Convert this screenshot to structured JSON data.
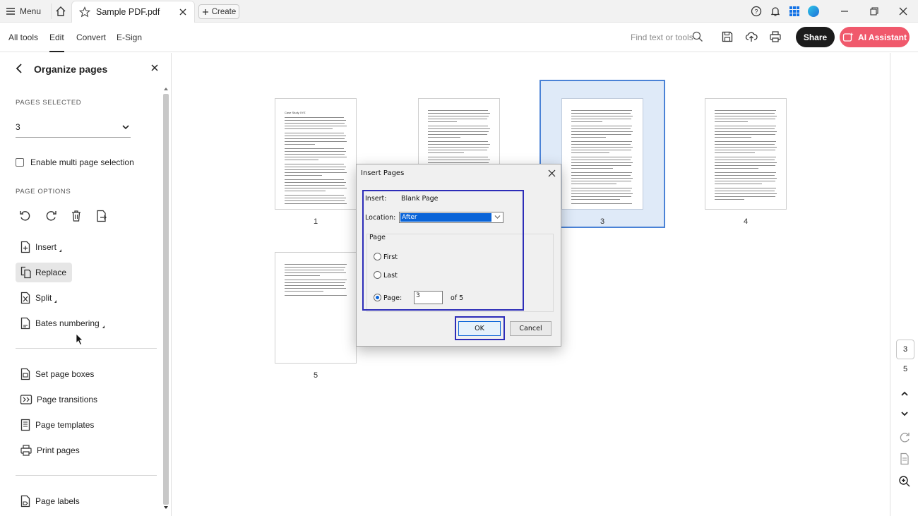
{
  "titlebar": {
    "menu_label": "Menu",
    "tab_name": "Sample PDF.pdf",
    "create_label": "Create",
    "icons": [
      "hamburger-icon",
      "home-icon",
      "star-icon",
      "close-icon",
      "plus-icon",
      "help-icon",
      "bell-icon",
      "apps-icon",
      "minimize-icon",
      "restore-icon",
      "close-window-icon"
    ]
  },
  "menubar": {
    "items": [
      "All tools",
      "Edit",
      "Convert",
      "E-Sign"
    ],
    "active": "Edit",
    "find_placeholder": "Find text or tools",
    "share_label": "Share",
    "ai_label": "AI Assistant",
    "colors": {
      "share_bg": "#1c1c1c",
      "ai_bg": "#f0596c"
    }
  },
  "panel": {
    "title": "Organize pages",
    "pages_selected_label": "PAGES SELECTED",
    "pages_selected_value": "3",
    "multi_select_label": "Enable multi page selection",
    "page_options_label": "PAGE OPTIONS",
    "tools": [
      "rotate-left-icon",
      "rotate-right-icon",
      "delete-icon",
      "extract-icon"
    ],
    "options": [
      {
        "label": "Insert",
        "has_menu": true
      },
      {
        "label": "Replace",
        "has_menu": false
      },
      {
        "label": "Split",
        "has_menu": true
      },
      {
        "label": "Bates numbering",
        "has_menu": true
      }
    ],
    "options2": [
      "Set page boxes",
      "Page transitions",
      "Page templates",
      "Print pages"
    ],
    "options3": [
      "Page labels"
    ]
  },
  "pages": [
    {
      "number": "1"
    },
    {
      "number": ""
    },
    {
      "number": "3"
    },
    {
      "number": "4"
    },
    {
      "number": "5"
    }
  ],
  "page1_heading": "Case Study XYZ",
  "right_rail": {
    "current_page": "3",
    "total_pages": "5"
  },
  "dialog": {
    "title": "Insert Pages",
    "insert_label": "Insert:",
    "insert_value": "Blank Page",
    "location_label": "Location:",
    "location_value": "After",
    "page_group_label": "Page",
    "first_label": "First",
    "last_label": "Last",
    "page_label": "Page:",
    "page_value": "3",
    "of_label": "of 5",
    "ok_label": "OK",
    "cancel_label": "Cancel",
    "selected_option": "Page",
    "highlight_color": "#2d2db8"
  }
}
